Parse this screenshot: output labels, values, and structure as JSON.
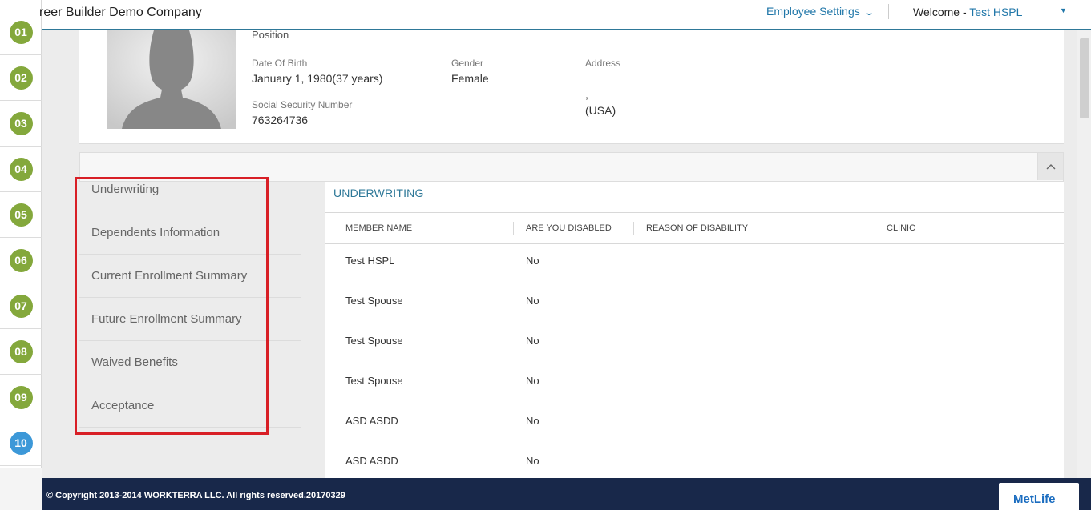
{
  "steps": [
    "01",
    "02",
    "03",
    "04",
    "05",
    "06",
    "07",
    "08",
    "09",
    "10"
  ],
  "active_step": "10",
  "header": {
    "company": "reer Builder Demo Company",
    "employee_settings": "Employee Settings",
    "welcome_label": "Welcome - ",
    "user_name": "Test HSPL"
  },
  "profile": {
    "position_label": "Position",
    "dob_label": "Date Of Birth",
    "dob_value": "January 1, 1980(37 years)",
    "gender_label": "Gender",
    "gender_value": "Female",
    "address_label": "Address",
    "address_line1": ",",
    "address_line2": "(USA)",
    "ssn_label": "Social Security Number",
    "ssn_value": "763264736"
  },
  "menu": {
    "items": [
      "Underwriting",
      "Dependents Information",
      "Current Enrollment Summary",
      "Future Enrollment Summary",
      "Waived Benefits",
      "Acceptance"
    ]
  },
  "underwriting": {
    "title": "UNDERWRITING",
    "columns": [
      "MEMBER NAME",
      "ARE YOU DISABLED",
      "REASON OF DISABILITY",
      "CLINIC"
    ],
    "rows": [
      {
        "member": "Test HSPL",
        "disabled": "No"
      },
      {
        "member": "Test Spouse",
        "disabled": "No"
      },
      {
        "member": "Test Spouse",
        "disabled": "No"
      },
      {
        "member": "Test Spouse",
        "disabled": "No"
      },
      {
        "member": "ASD ASDD",
        "disabled": "No"
      },
      {
        "member": "ASD ASDD",
        "disabled": "No"
      }
    ]
  },
  "footer": {
    "copyright": "© Copyright 2013-2014 WORKTERRA LLC. All rights reserved.20170329",
    "brand": "MetLife"
  },
  "colors": {
    "step_complete": "#84a83c",
    "step_active": "#3c98d8",
    "accent": "#2e7898",
    "footer_bg": "#18284a",
    "highlight": "#d81f26"
  }
}
